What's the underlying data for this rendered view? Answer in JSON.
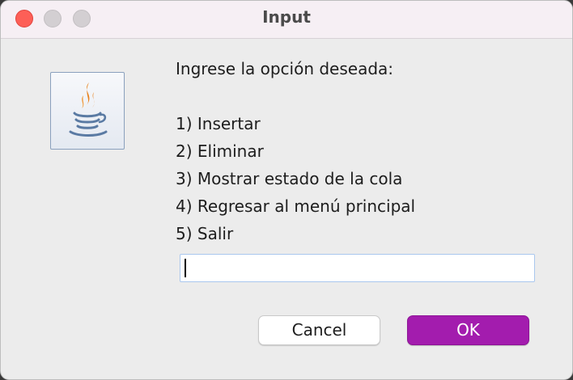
{
  "window": {
    "title": "Input",
    "controls": {
      "close": "close-icon",
      "minimize": "minimize-icon",
      "maximize": "maximize-icon"
    }
  },
  "dialog": {
    "icon": "java-coffee-cup-icon",
    "prompt": "Ingrese la opción deseada:",
    "options": [
      "1) Insertar",
      "2) Eliminar",
      "3) Mostrar estado de la cola",
      "4) Regresar al menú principal",
      "5) Salir"
    ],
    "input": {
      "value": "",
      "placeholder": ""
    },
    "buttons": {
      "cancel_label": "Cancel",
      "ok_label": "OK"
    }
  },
  "colors": {
    "accent": "#a31cae",
    "close": "#fd5f57",
    "background": "#ececec",
    "titlebar": "#f6eff4"
  }
}
